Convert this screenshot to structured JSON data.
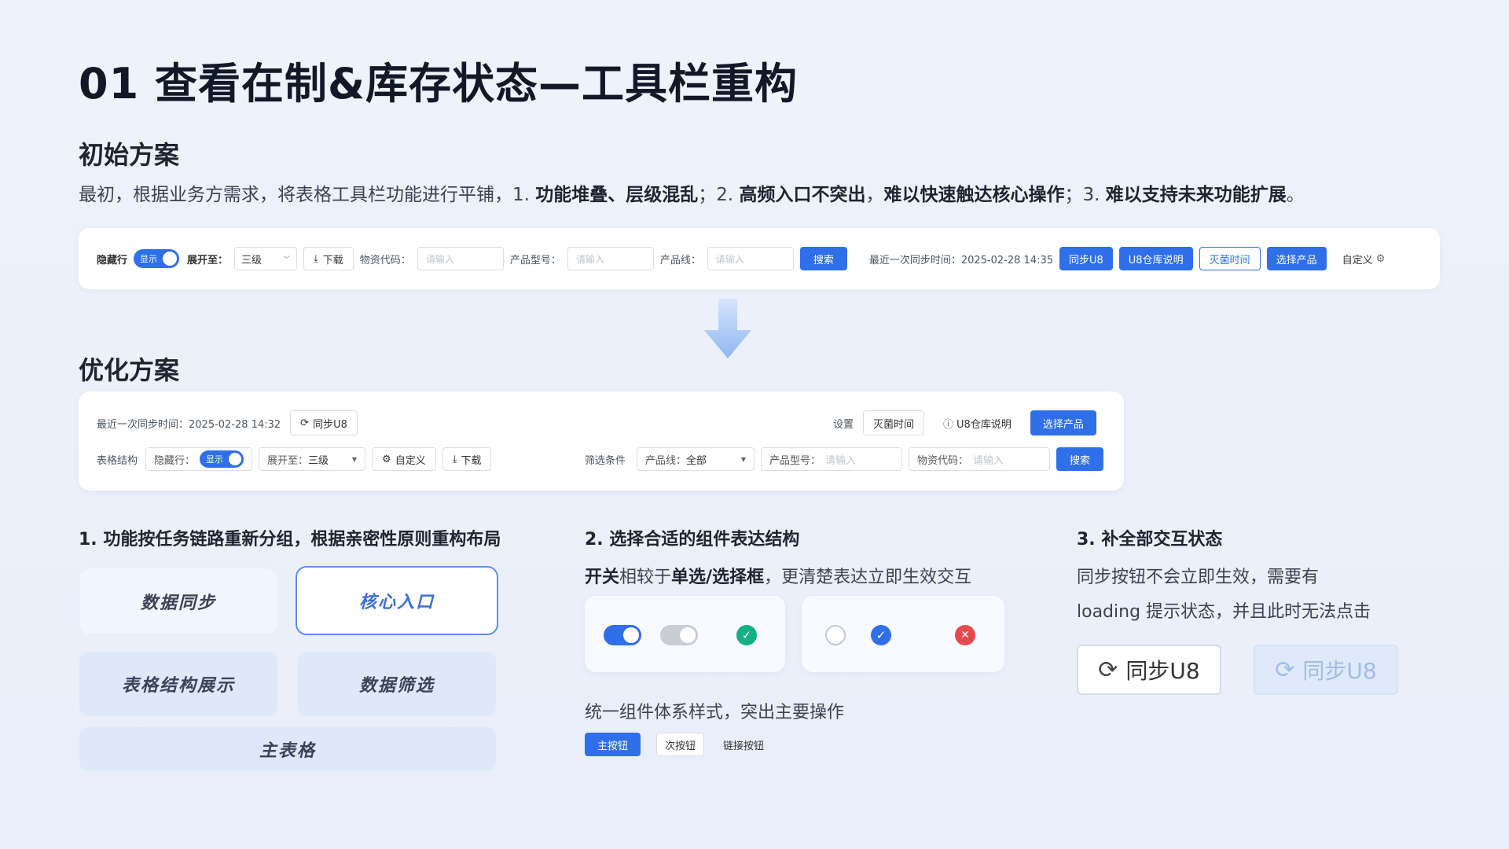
{
  "title": "01 查看在制&库存状态—工具栏重构",
  "initial": {
    "heading": "初始方案",
    "desc_parts": [
      "最初，根据业务方需求，将表格工具栏功能进行平铺，1. ",
      "功能堆叠、层级混乱",
      "；2. ",
      "高频入口不突出",
      "，",
      "难以快速触达核心操作",
      "；3. ",
      "难以支持未来功能扩展",
      "。"
    ],
    "toolbar": {
      "hide_rows": "隐藏行",
      "toggle_text": "显示",
      "expand_to": "展开至：",
      "expand_value": "三级",
      "download": "下载",
      "material_code": "物资代码：",
      "product_model": "产品型号：",
      "product_line": "产品线：",
      "placeholder": "请输入",
      "search": "搜索",
      "last_sync": "最近一次同步时间：2025-02-28  14:35",
      "sync_u8": "同步U8",
      "u8_desc": "U8仓库说明",
      "sterilize_time": "灭菌时间",
      "select_product": "选择产品",
      "custom": "自定义"
    }
  },
  "optimized": {
    "heading": "优化方案",
    "toolbar": {
      "last_sync": "最近一次同步时间：2025-02-28  14:32",
      "sync_u8": "同步U8",
      "settings": "设置",
      "sterilize_time": "灭菌时间",
      "u8_desc": "U8仓库说明",
      "select_product": "选择产品",
      "table_structure": "表格结构",
      "hide_rows": "隐藏行：",
      "toggle_text": "显示",
      "expand_to": "展开至：",
      "expand_value": "三级",
      "custom": "自定义",
      "download": "下载",
      "filter": "筛选条件",
      "product_line": "产品线：",
      "product_line_value": "全部",
      "product_model": "产品型号：",
      "material_code": "物资代码：",
      "placeholder": "请输入",
      "search": "搜索"
    }
  },
  "point1": {
    "heading": "1. 功能按任务链路重新分组，根据亲密性原则重构布局",
    "blocks": {
      "data_sync": "数据同步",
      "core_entry": "核心入口",
      "table_display": "表格结构展示",
      "data_filter": "数据筛选",
      "main_table": "主表格"
    }
  },
  "point2": {
    "heading": "2.  选择合适的组件表达结构",
    "sub_parts": [
      "开关",
      "相较于",
      "单选/选择框",
      "，更清楚表达立即生效交互"
    ],
    "unify": "统一组件体系样式，突出主要操作",
    "primary_btn": "主按钮",
    "secondary_btn": "次按钮",
    "link_btn": "链接按钮"
  },
  "point3": {
    "heading": "3.  补全部交互状态",
    "line1": "同步按钮不会立即生效，需要有",
    "line2": "loading 提示状态，并且此时无法点击",
    "sync_normal": "同步U8",
    "sync_loading": "同步U8"
  },
  "colors": {
    "primary": "#2f6fea",
    "success": "#12b085",
    "danger": "#e5484d"
  }
}
